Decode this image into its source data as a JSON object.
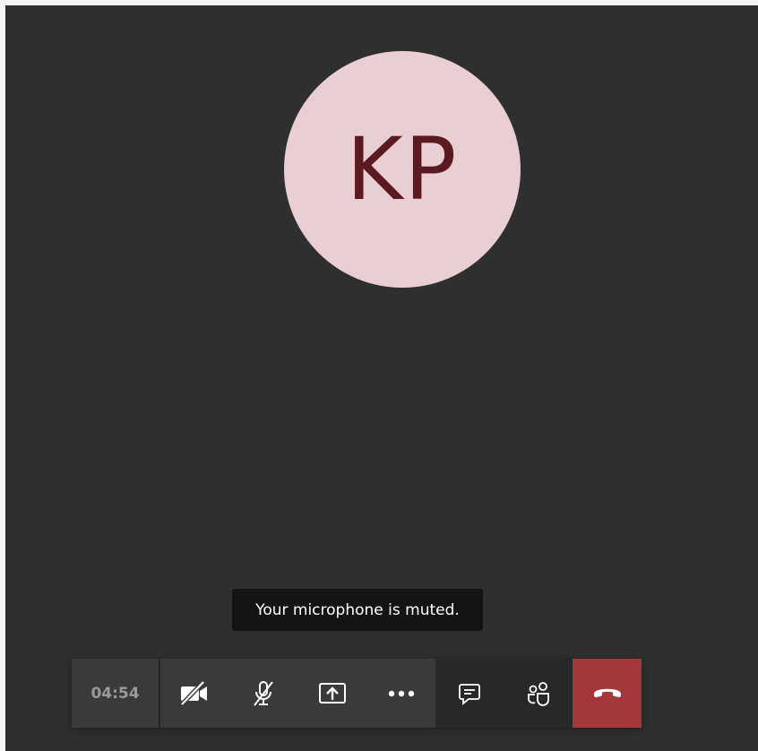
{
  "participant": {
    "initials": "KP",
    "avatar_color": "#e9cfd4",
    "initials_color": "#5a1a1f"
  },
  "tooltip": {
    "text": "Your microphone is muted."
  },
  "call_bar": {
    "timer": "04:54",
    "buttons": [
      {
        "icon": "camera-off-icon"
      },
      {
        "icon": "mic-off-icon"
      },
      {
        "icon": "share-screen-icon"
      },
      {
        "icon": "more-options-icon"
      },
      {
        "icon": "chat-icon"
      },
      {
        "icon": "participants-icon"
      },
      {
        "icon": "hang-up-icon"
      }
    ],
    "hangup_color": "#a4373a"
  },
  "colors": {
    "stage_background": "#302f2f",
    "controls_background": "#3b3a39",
    "side_background": "#292828"
  }
}
